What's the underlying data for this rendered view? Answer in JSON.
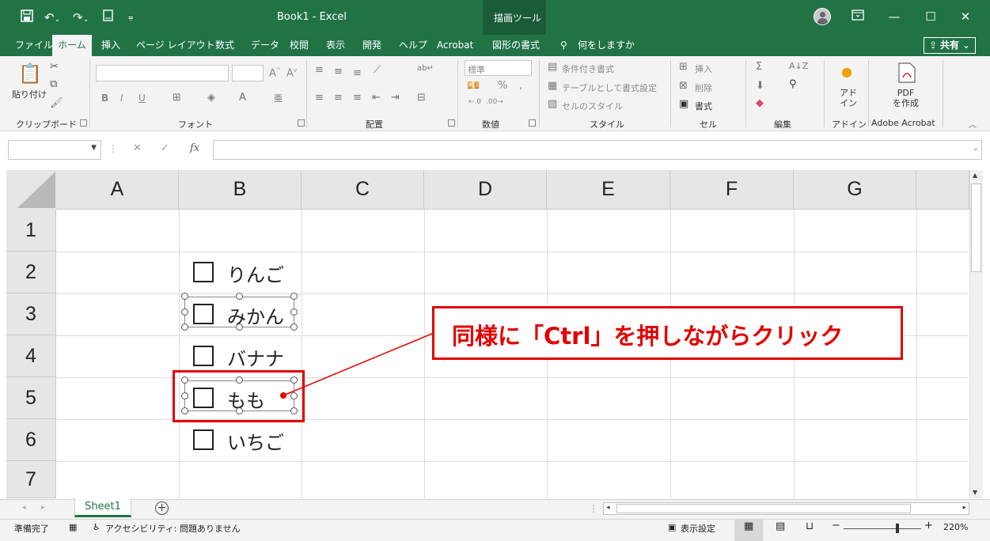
{
  "titlebar": {
    "title": "Book1  -  Excel",
    "contextual_tab": "描画ツール",
    "colors": {
      "accent": "#217346",
      "callout": "#e30000"
    }
  },
  "menu": {
    "tabs": [
      "ファイル",
      "ホーム",
      "挿入",
      "ページ レイアウト",
      "数式",
      "データ",
      "校閲",
      "表示",
      "開発",
      "ヘルプ",
      "Acrobat",
      "図形の書式"
    ],
    "tell_me": "何をしますか",
    "share": "共有"
  },
  "ribbon": {
    "clipboard": {
      "paste": "貼り付け",
      "label": "クリップボード"
    },
    "font": {
      "label": "フォント",
      "bold": "B",
      "italic": "I",
      "underline": "U"
    },
    "alignment": {
      "label": "配置"
    },
    "number": {
      "format": "標準",
      "percent": "%",
      "comma": ",",
      "label": "数値"
    },
    "styles": {
      "conditional": "条件付き書式",
      "as_table": "テーブルとして書式設定",
      "cell_styles": "セルのスタイル",
      "label": "スタイル"
    },
    "cells": {
      "insert": "挿入",
      "delete": "削除",
      "format": "書式",
      "label": "セル"
    },
    "editing": {
      "label": "編集"
    },
    "addins": {
      "button": "アド\nイン",
      "label": "アドイン"
    },
    "acrobat": {
      "button": "PDF\nを作成",
      "label": "Adobe Acrobat"
    }
  },
  "formula_bar": {
    "fx": "fx",
    "name_box": "",
    "value": ""
  },
  "sheet": {
    "columns": [
      "A",
      "B",
      "C",
      "D",
      "E",
      "F",
      "G"
    ],
    "rows": [
      "1",
      "2",
      "3",
      "4",
      "5",
      "6",
      "7"
    ],
    "checkboxes": [
      "りんご",
      "みかん",
      "バナナ",
      "もも",
      "いちご"
    ],
    "selected": [
      false,
      true,
      false,
      true,
      false
    ]
  },
  "callout": {
    "text": "同様に「Ctrl」を押しながらクリック"
  },
  "sheet_tabs": {
    "active": "Sheet1"
  },
  "statusbar": {
    "ready": "準備完了",
    "accessibility": "アクセシビリティ: 問題ありません",
    "display_settings": "表示設定",
    "zoom": "220%"
  }
}
